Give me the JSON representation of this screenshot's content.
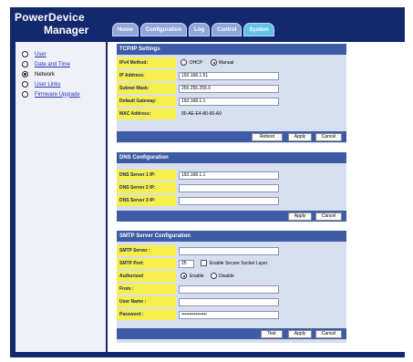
{
  "app": {
    "title_line1": "PowerDevice",
    "title_line2": "Manager"
  },
  "tabs": [
    "Home",
    "Configuration",
    "Log",
    "Control",
    "System"
  ],
  "active_tab": "System",
  "nav": {
    "items": [
      {
        "label": "User",
        "selected": false
      },
      {
        "label": "Date and Time",
        "selected": false
      },
      {
        "label": "Network",
        "selected": true
      },
      {
        "label": "User Links",
        "selected": false
      },
      {
        "label": "Firmware Upgrade",
        "selected": false
      }
    ]
  },
  "tcpip": {
    "title": "TCP/IP Settings",
    "ipv4_label": "IPv4 Method:",
    "dhcp_label": "DHCP",
    "manual_label": "Manual",
    "method_selected": "Manual",
    "ip_label": "IP Address:",
    "ip_value": "192.168.1.51",
    "subnet_label": "Subnet Mask:",
    "subnet_value": "255.255.255.0",
    "gateway_label": "Default Gateway:",
    "gateway_value": "192.168.1.1",
    "mac_label": "MAC Address:",
    "mac_value": "00-AE-E4-80-66-A9",
    "reboot": "Reboot",
    "apply": "Apply",
    "cancel": "Cancel"
  },
  "dns": {
    "title": "DNS Configuration",
    "server1_label": "DNS Server 1 IP:",
    "server1_value": "192.168.1.1",
    "server2_label": "DNS Server 2 IP:",
    "server2_value": "",
    "server3_label": "DNS Server 3 IP:",
    "server3_value": "",
    "apply": "Apply",
    "cancel": "Cancel"
  },
  "smtp": {
    "title": "SMTP Server Configuration",
    "server_label": "SMTP Server :",
    "server_value": "",
    "port_label": "SMTP Port:",
    "port_value": "25",
    "ssl_label": "Enable Secure Socket Layer",
    "ssl_checked": false,
    "auth_label": "Authorized",
    "enable_label": "Enable",
    "disable_label": "Disable",
    "auth_selected": "Enable",
    "from_label": "From :",
    "from_value": "",
    "username_label": "User Name :",
    "username_value": "",
    "password_label": "Password :",
    "password_value": "••••••••••••••••",
    "test": "Test",
    "apply": "Apply",
    "cancel": "Cancel"
  }
}
